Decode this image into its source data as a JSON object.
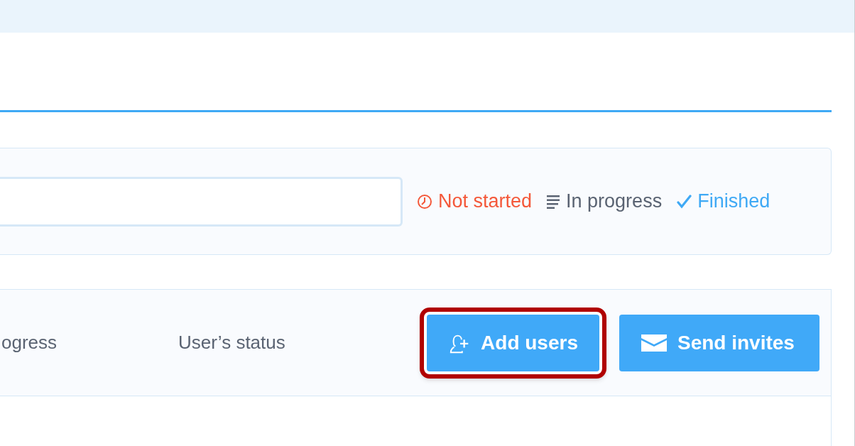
{
  "legend": [
    {
      "kind": "clock",
      "label": "Not started",
      "color": "#f4583a"
    },
    {
      "kind": "lines",
      "label": "In progress",
      "color": "#5a6372"
    },
    {
      "kind": "check",
      "label": "Finished",
      "color": "#3fa9f5"
    }
  ],
  "table": {
    "columns": [
      "ogress",
      "User’s status"
    ]
  },
  "buttons": [
    {
      "kind": "add-user",
      "label": "Add users",
      "highlighted": true
    },
    {
      "kind": "mail",
      "label": "Send invites",
      "highlighted": false
    }
  ]
}
